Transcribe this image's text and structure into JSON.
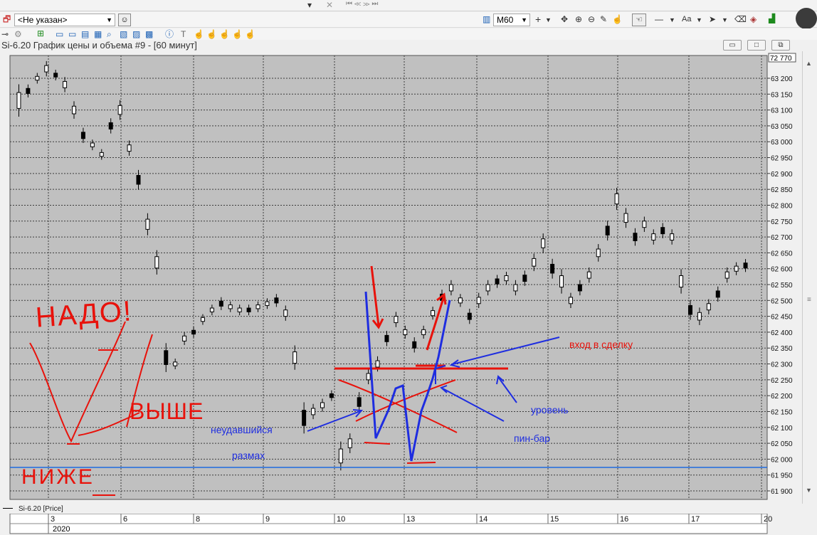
{
  "toolbar": {
    "instrument_select": "<Не указан>",
    "timeframe_select": "M60",
    "font_label": "Aa"
  },
  "chart": {
    "title": "Si-6.20 График цены и объема #9 - [60 минут]",
    "price_badge": "72 770",
    "legend": "Si-6.20 [Price]",
    "year": "2020",
    "price_ticks": [
      "63 200",
      "63 150",
      "63 100",
      "63 050",
      "63 000",
      "62 950",
      "62 900",
      "62 850",
      "62 800",
      "62 750",
      "62 700",
      "62 650",
      "62 600",
      "62 550",
      "62 500",
      "62 450",
      "62 400",
      "62 350",
      "62 300",
      "62 250",
      "62 200",
      "62 150",
      "62 100",
      "62 050",
      "62 000",
      "61 950",
      "61 900"
    ],
    "date_ticks": [
      "3",
      "6",
      "8",
      "9",
      "10",
      "13",
      "14",
      "15",
      "16",
      "17",
      "20"
    ],
    "colors": {
      "background": "#c0c0c0",
      "grid": "#3c3c3c",
      "candle": "#000000",
      "level_line": "#1e6be0",
      "red_annotation": "#e8120b",
      "blue_annotation": "#1e2de0"
    }
  },
  "annotations": {
    "nado": "НАДО!",
    "vyshe": "ВЫШЕ",
    "nizhe": "НИЖЕ",
    "entry": "вход в сделку",
    "level": "уровень",
    "pinbar": "пин-бар",
    "failed": "неудавшийся",
    "swing": "размах"
  }
}
